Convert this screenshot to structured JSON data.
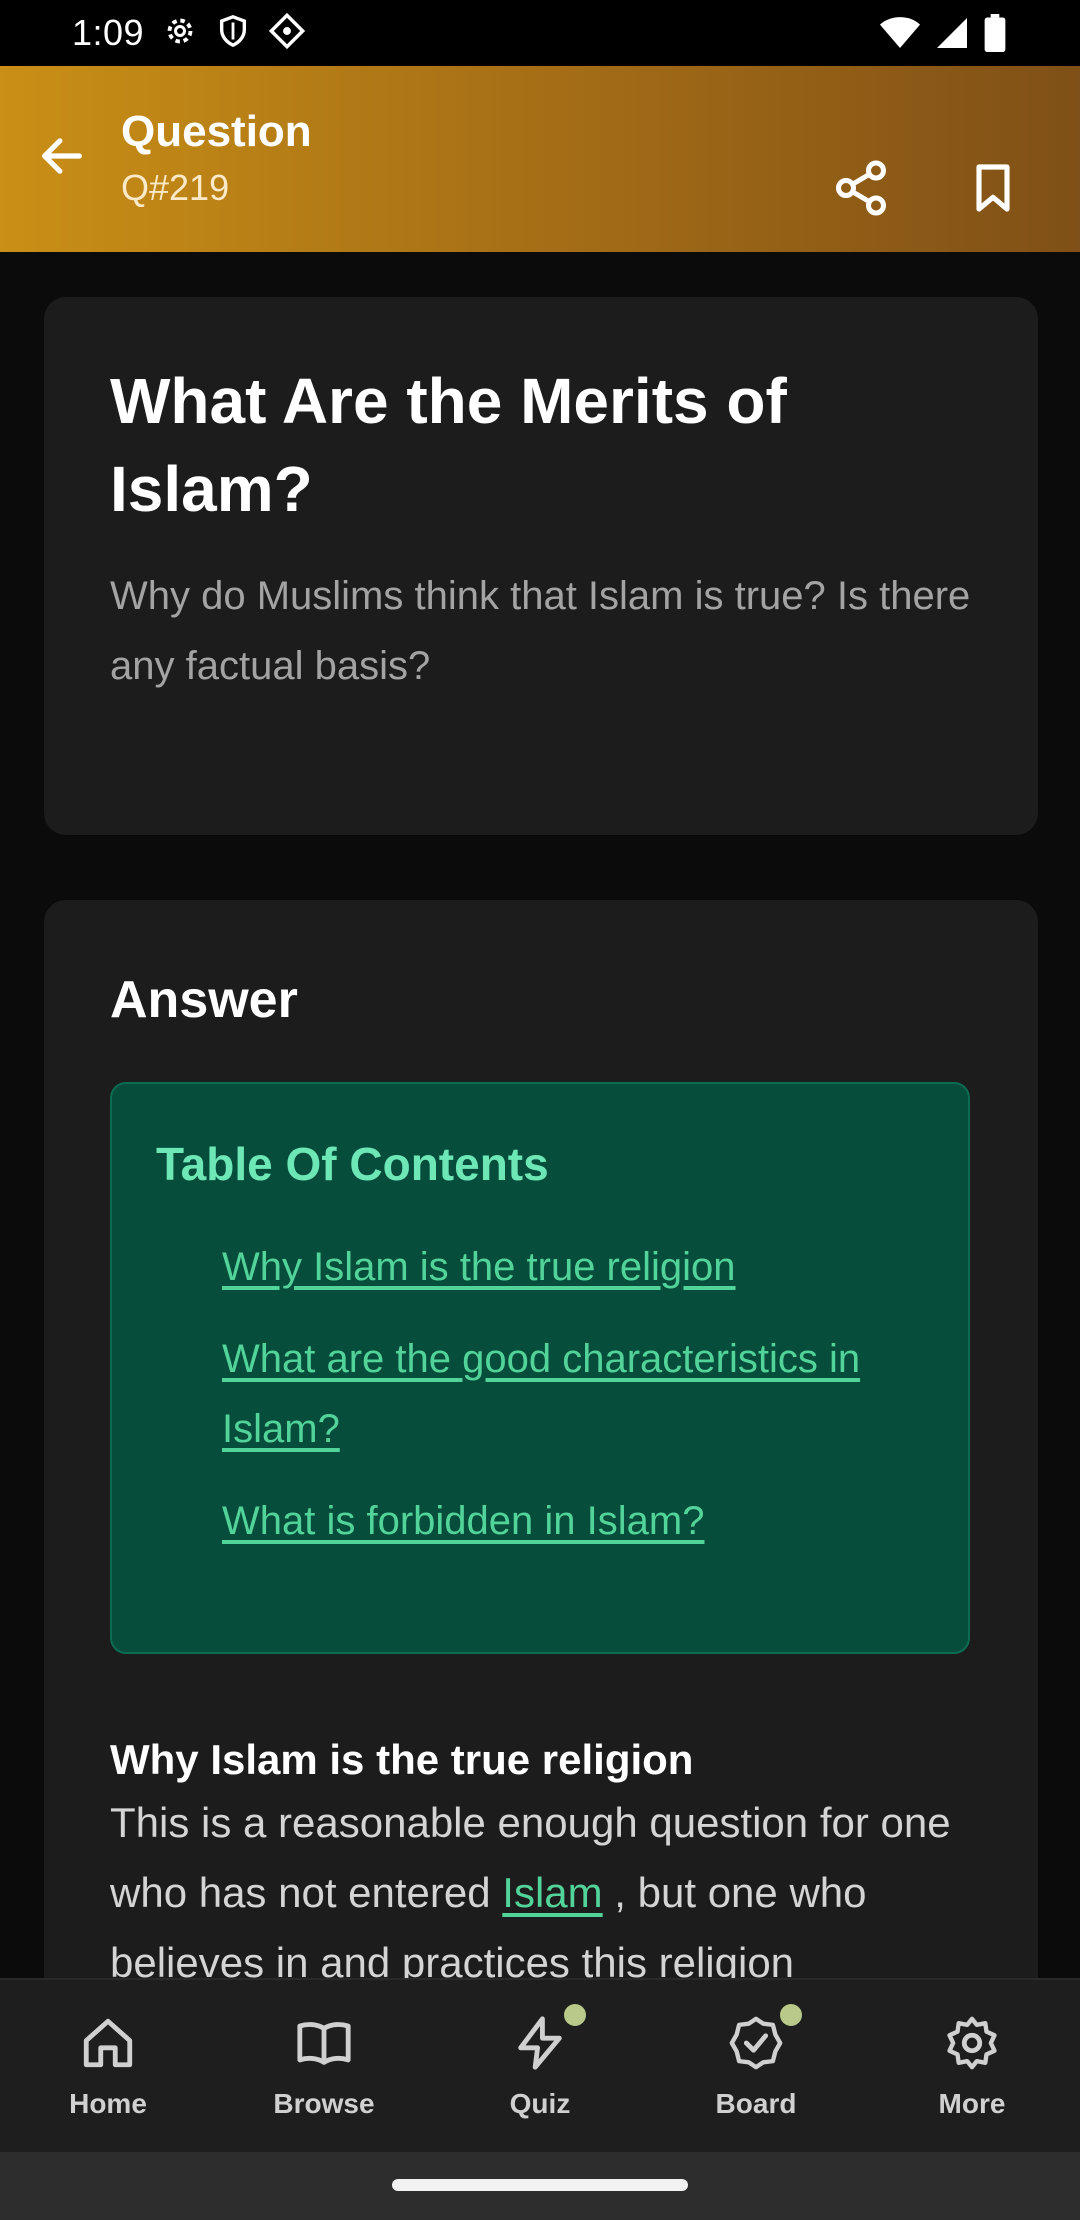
{
  "status_bar": {
    "time": "1:09",
    "icons": [
      "gear-icon",
      "shield-icon",
      "diamond-icon",
      "wifi-icon",
      "signal-icon",
      "battery-icon"
    ]
  },
  "app_bar": {
    "title": "Question",
    "subtitle": "Q#219",
    "back_icon": "arrow-left-icon",
    "share_icon": "share-icon",
    "bookmark_icon": "bookmark-icon",
    "gradient": [
      "#c98f16",
      "#7f5017"
    ]
  },
  "question": {
    "title": "What Are the Merits of Islam?",
    "description": "Why do Muslims think that Islam is true? Is there any factual basis?"
  },
  "answer": {
    "heading": "Answer",
    "toc": {
      "title": "Table Of Contents",
      "items": [
        "Why Islam is the true religion",
        "What are the good characteristics in Islam?",
        "What is forbidden in Islam?"
      ]
    },
    "section": {
      "heading": "Why Islam is the true religion",
      "body_before": "This is a reasonable enough question for one who has not entered ",
      "link": "Islam",
      "body_after": " , but one who believes in and practices this religion"
    }
  },
  "bottom_nav": {
    "items": [
      {
        "label": "Home",
        "icon": "home-icon",
        "dot": false
      },
      {
        "label": "Browse",
        "icon": "book-icon",
        "dot": false
      },
      {
        "label": "Quiz",
        "icon": "lightning-icon",
        "dot": true
      },
      {
        "label": "Board",
        "icon": "badge-check-icon",
        "dot": true
      },
      {
        "label": "More",
        "icon": "gear-icon",
        "dot": false
      }
    ]
  },
  "colors": {
    "background": "#0b0b0b",
    "card": "#1c1c1c",
    "toc_bg": "#064e3b",
    "accent_green": "#52d39a",
    "nav_dot": "#b8c98a"
  }
}
